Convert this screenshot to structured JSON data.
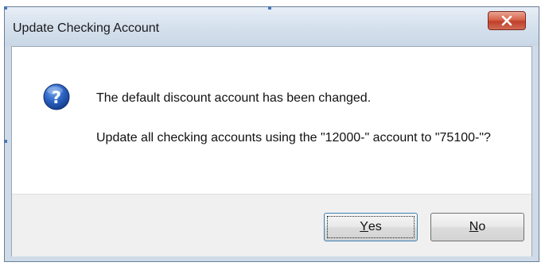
{
  "dialog": {
    "title": "Update Checking Account",
    "icon": "question-icon",
    "message_line1": "The default discount account has been changed.",
    "message_line2": "Update all checking accounts using the \"12000-\" account to \"75100-\"?",
    "buttons": {
      "yes_mnemonic": "Y",
      "yes_rest": "es",
      "no_mnemonic": "N",
      "no_rest": "o"
    }
  }
}
